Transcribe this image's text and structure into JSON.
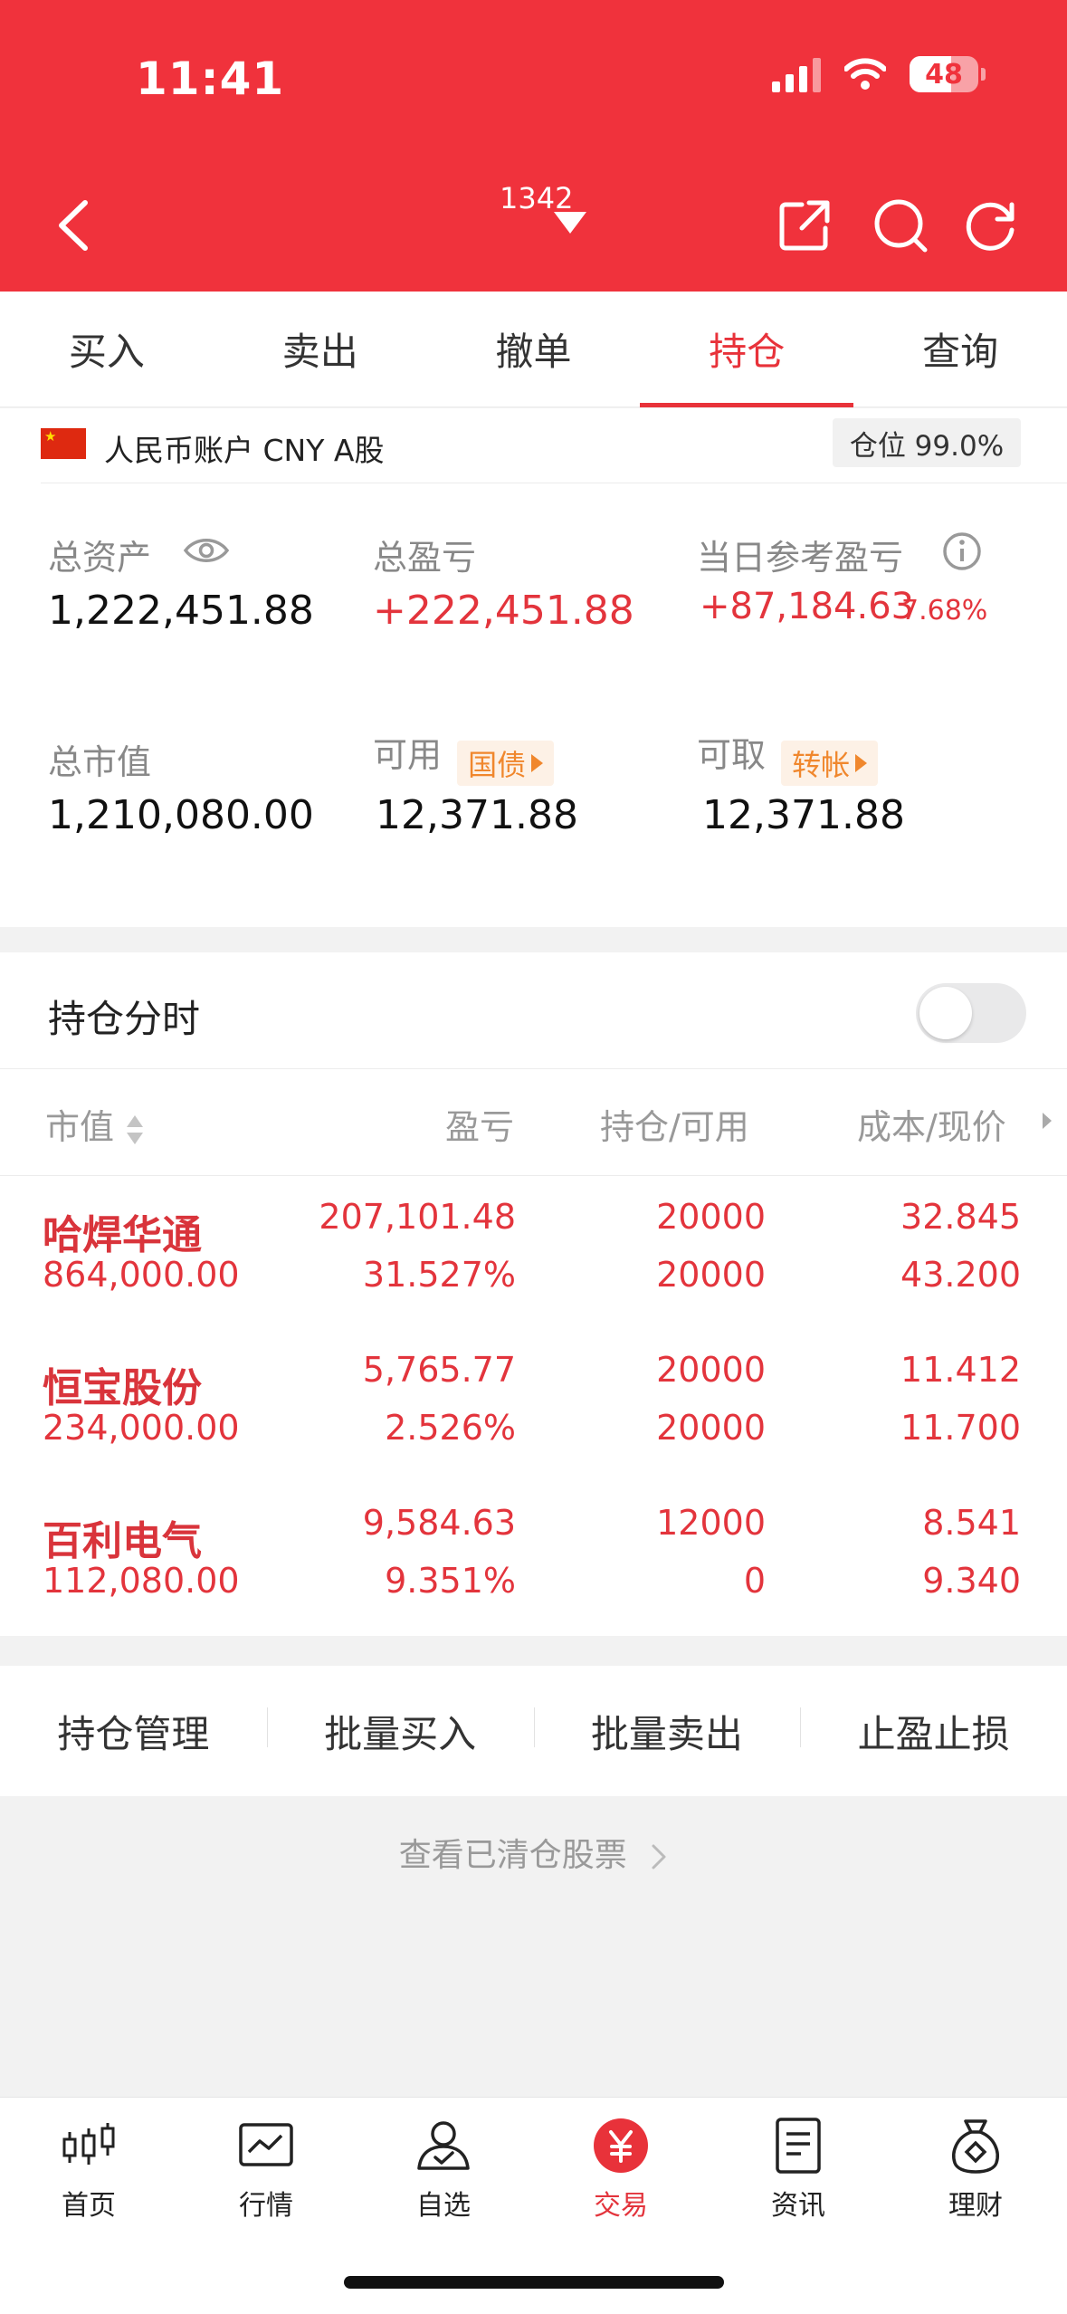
{
  "status_bar": {
    "time": "11:41",
    "battery": "48"
  },
  "header": {
    "account_number": "1342"
  },
  "tabs": [
    {
      "label": "买入",
      "active": false
    },
    {
      "label": "卖出",
      "active": false
    },
    {
      "label": "撤单",
      "active": false
    },
    {
      "label": "持仓",
      "active": true
    },
    {
      "label": "查询",
      "active": false
    }
  ],
  "account": {
    "name": "人民币账户 CNY A股",
    "position_badge": "仓位 99.0%"
  },
  "summary": {
    "total_assets_label": "总资产",
    "total_assets": "1,222,451.88",
    "total_pnl_label": "总盈亏",
    "total_pnl": "+222,451.88",
    "daily_pnl_label": "当日参考盈亏",
    "daily_pnl": "+87,184.63",
    "daily_pnl_pct": "7.68%",
    "market_value_label": "总市值",
    "market_value": "1,210,080.00",
    "available_label": "可用",
    "available_tag": "国债",
    "available": "12,371.88",
    "withdrawable_label": "可取",
    "withdrawable_tag": "转帐",
    "withdrawable": "12,371.88"
  },
  "holdings": {
    "title": "持仓分时",
    "toggle_on": false,
    "columns": [
      "市值",
      "盈亏",
      "持仓/可用",
      "成本/现价"
    ],
    "rows": [
      {
        "name": "哈焊华通",
        "market_value": "864,000.00",
        "pnl": "207,101.48",
        "pnl_pct": "31.527%",
        "position": "20000",
        "available": "20000",
        "cost": "32.845",
        "price": "43.200"
      },
      {
        "name": "恒宝股份",
        "market_value": "234,000.00",
        "pnl": "5,765.77",
        "pnl_pct": "2.526%",
        "position": "20000",
        "available": "20000",
        "cost": "11.412",
        "price": "11.700"
      },
      {
        "name": "百利电气",
        "market_value": "112,080.00",
        "pnl": "9,584.63",
        "pnl_pct": "9.351%",
        "position": "12000",
        "available": "0",
        "cost": "8.541",
        "price": "9.340"
      }
    ]
  },
  "actions": [
    "持仓管理",
    "批量买入",
    "批量卖出",
    "止盈止损"
  ],
  "cleared_link": "查看已清仓股票",
  "bottom_nav": [
    {
      "label": "首页",
      "icon": "candlestick-icon",
      "active": false
    },
    {
      "label": "行情",
      "icon": "chart-monitor-icon",
      "active": false
    },
    {
      "label": "自选",
      "icon": "user-check-icon",
      "active": false
    },
    {
      "label": "交易",
      "icon": "yuan-coin-icon",
      "active": true
    },
    {
      "label": "资讯",
      "icon": "document-icon",
      "active": false
    },
    {
      "label": "理财",
      "icon": "money-bag-icon",
      "active": false
    }
  ]
}
